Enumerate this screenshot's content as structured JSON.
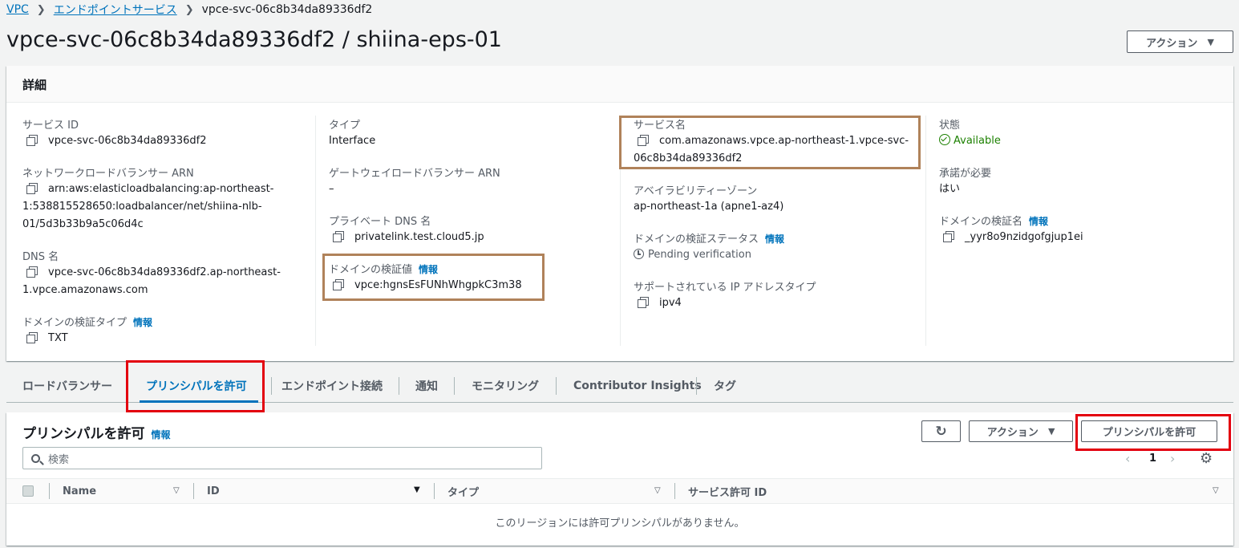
{
  "breadcrumb": {
    "items": [
      "VPC",
      "エンドポイントサービス",
      "vpce-svc-06c8b34da89336df2"
    ]
  },
  "page_title": "vpce-svc-06c8b34da89336df2 / shiina-eps-01",
  "header_action_label": "アクション",
  "details": {
    "heading": "詳細",
    "info_label": "情報",
    "col1": {
      "service_id_label": "サービス ID",
      "service_id": "vpce-svc-06c8b34da89336df2",
      "nlb_arn_label": "ネットワークロードバランサー ARN",
      "nlb_arn_line1": "arn:aws:elasticloadbalancing:ap-northeast-",
      "nlb_arn_line2": "1:538815528650:loadbalancer/net/shiina-nlb-",
      "nlb_arn_line3": "01/5d3b33b9a5c06d4c",
      "dns_label": "DNS 名",
      "dns_line1": "vpce-svc-06c8b34da89336df2.ap-northeast-",
      "dns_line2": "1.vpce.amazonaws.com",
      "verif_type_label": "ドメインの検証タイプ",
      "verif_type": "TXT"
    },
    "col2": {
      "type_label": "タイプ",
      "type": "Interface",
      "gwlb_arn_label": "ゲートウェイロードバランサー ARN",
      "gwlb_arn": "–",
      "private_dns_label": "プライベート DNS 名",
      "private_dns": "privatelink.test.cloud5.jp",
      "verif_value_label": "ドメインの検証値",
      "verif_value": "vpce:hgnsEsFUNhWhgpkC3m38"
    },
    "col3": {
      "service_name_label": "サービス名",
      "service_name_line1": "com.amazonaws.vpce.ap-northeast-1.vpce-svc-",
      "service_name_line2": "06c8b34da89336df2",
      "az_label": "アベイラビリティーゾーン",
      "az": "ap-northeast-1a (apne1-az4)",
      "verif_status_label": "ドメインの検証ステータス",
      "verif_status": "Pending verification",
      "ip_type_label": "サポートされている IP アドレスタイプ",
      "ip_type": "ipv4"
    },
    "col4": {
      "state_label": "状態",
      "state": "Available",
      "acceptance_label": "承諾が必要",
      "acceptance": "はい",
      "verif_name_label": "ドメインの検証名",
      "verif_name": "_yyr8o9nzidgofgjup1ei"
    }
  },
  "tabs": [
    "ロードバランサー",
    "プリンシパルを許可",
    "エンドポイント接続",
    "通知",
    "モニタリング",
    "Contributor Insights",
    "タグ"
  ],
  "principals": {
    "heading": "プリンシパルを許可",
    "info_label": "情報",
    "action_label": "アクション",
    "allow_button": "プリンシパルを許可",
    "search_placeholder": "検索",
    "page": "1",
    "columns": [
      "Name",
      "ID",
      "タイプ",
      "サービス許可 ID"
    ],
    "empty_message": "このリージョンには許可プリンシパルがありません。"
  },
  "colors": {
    "link": "#0073bb",
    "success": "#1d8102",
    "highlight_brown": "#b0825a",
    "highlight_red": "#e3000f"
  }
}
